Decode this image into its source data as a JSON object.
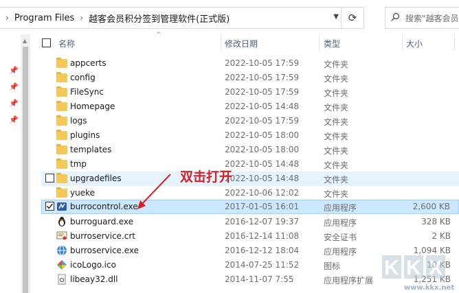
{
  "address_bar": {
    "path": [
      "Program Files",
      "越客会员积分签到管理软件(正式版)"
    ],
    "search_placeholder": "搜索\"越客会员"
  },
  "columns": {
    "name": "名称",
    "date": "修改日期",
    "type": "类型",
    "size": "大小"
  },
  "files": [
    {
      "name": "appcerts",
      "date": "2022-10-05 17:59",
      "type": "文件夹",
      "size": "",
      "icon": "folder-icon"
    },
    {
      "name": "config",
      "date": "2022-10-05 17:59",
      "type": "文件夹",
      "size": "",
      "icon": "folder-icon"
    },
    {
      "name": "FileSync",
      "date": "2022-10-05 17:59",
      "type": "文件夹",
      "size": "",
      "icon": "folder-icon"
    },
    {
      "name": "Homepage",
      "date": "2022-10-05 14:48",
      "type": "文件夹",
      "size": "",
      "icon": "folder-icon"
    },
    {
      "name": "logs",
      "date": "2022-10-05 17:59",
      "type": "文件夹",
      "size": "",
      "icon": "folder-icon"
    },
    {
      "name": "plugins",
      "date": "2022-10-05 18:00",
      "type": "文件夹",
      "size": "",
      "icon": "folder-icon"
    },
    {
      "name": "templates",
      "date": "2022-10-05 18:00",
      "type": "文件夹",
      "size": "",
      "icon": "folder-icon"
    },
    {
      "name": "tmp",
      "date": "2022-10-05 14:48",
      "type": "文件夹",
      "size": "",
      "icon": "folder-icon"
    },
    {
      "name": "upgradefiles",
      "date": "2022-10-05 14:48",
      "type": "文件夹",
      "size": "",
      "icon": "folder-icon"
    },
    {
      "name": "yueke",
      "date": "2022-10-06 12:02",
      "type": "文件夹",
      "size": "",
      "icon": "folder-icon"
    },
    {
      "name": "burrocontrol.exe",
      "date": "2017-01-05 16:01",
      "type": "应用程序",
      "size": "2,600 KB",
      "icon": "exe-icon"
    },
    {
      "name": "burroguard.exe",
      "date": "2016-12-07 19:37",
      "type": "应用程序",
      "size": "328 KB",
      "icon": "penguin-icon"
    },
    {
      "name": "burroservice.crt",
      "date": "2016-12-14 11:08",
      "type": "安全证书",
      "size": "2 KB",
      "icon": "certificate-icon"
    },
    {
      "name": "burroservice.exe",
      "date": "2016-12-12 18:04",
      "type": "应用程序",
      "size": "1,094 KB",
      "icon": "globe-icon"
    },
    {
      "name": "icoLogo.ico",
      "date": "2014-07-25 11:52",
      "type": "图标",
      "size": "10 KB",
      "icon": "diamond-icon"
    },
    {
      "name": "libeay32.dll",
      "date": "2014-11-07 7:55",
      "type": "应用程序扩展",
      "size": "1,251 KB",
      "icon": "dll-icon"
    }
  ],
  "annotation": {
    "text": "双击打开",
    "color": "#d81e1e"
  },
  "watermark": {
    "text": "www.kkx.net"
  },
  "colors": {
    "hover_row": "#e5f3ff",
    "selected_row": "#cce8ff",
    "selected_border": "#99d1ff",
    "folder": "#f5c85a"
  }
}
